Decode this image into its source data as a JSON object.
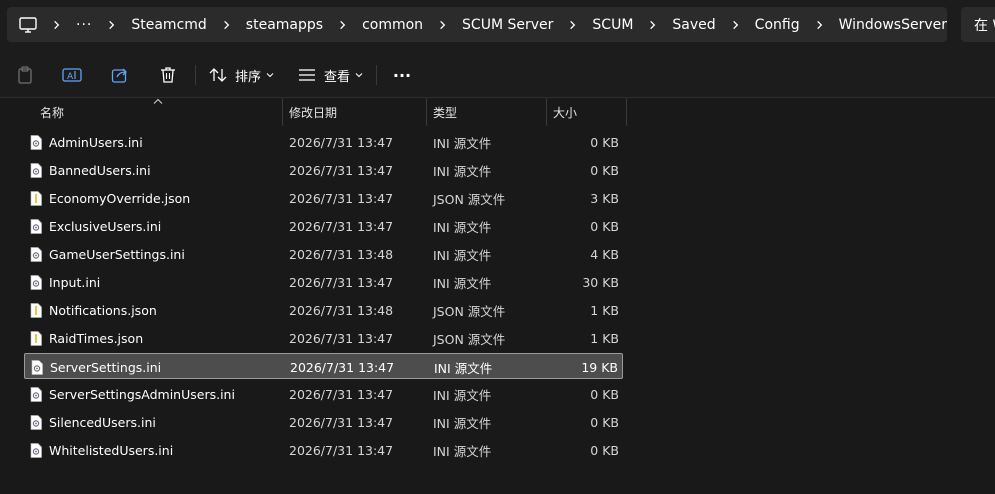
{
  "address_bar": {
    "more_label": "···",
    "crumbs": [
      "Steamcmd",
      "steamapps",
      "common",
      "SCUM Server",
      "SCUM",
      "Saved",
      "Config",
      "WindowsServer"
    ]
  },
  "search": {
    "placeholder": "在 W"
  },
  "toolbar": {
    "sort_label": "排序",
    "view_label": "查看",
    "more_label": "···"
  },
  "columns": {
    "name": "名称",
    "date": "修改日期",
    "type": "类型",
    "size": "大小"
  },
  "files": [
    {
      "name": "AdminUsers.ini",
      "date": "2026/7/31 13:47",
      "type": "INI 源文件",
      "size": "0 KB",
      "kind": "ini"
    },
    {
      "name": "BannedUsers.ini",
      "date": "2026/7/31 13:47",
      "type": "INI 源文件",
      "size": "0 KB",
      "kind": "ini"
    },
    {
      "name": "EconomyOverride.json",
      "date": "2026/7/31 13:47",
      "type": "JSON 源文件",
      "size": "3 KB",
      "kind": "json"
    },
    {
      "name": "ExclusiveUsers.ini",
      "date": "2026/7/31 13:47",
      "type": "INI 源文件",
      "size": "0 KB",
      "kind": "ini"
    },
    {
      "name": "GameUserSettings.ini",
      "date": "2026/7/31 13:48",
      "type": "INI 源文件",
      "size": "4 KB",
      "kind": "ini"
    },
    {
      "name": "Input.ini",
      "date": "2026/7/31 13:47",
      "type": "INI 源文件",
      "size": "30 KB",
      "kind": "ini"
    },
    {
      "name": "Notifications.json",
      "date": "2026/7/31 13:48",
      "type": "JSON 源文件",
      "size": "1 KB",
      "kind": "json"
    },
    {
      "name": "RaidTimes.json",
      "date": "2026/7/31 13:47",
      "type": "JSON 源文件",
      "size": "1 KB",
      "kind": "json"
    },
    {
      "name": "ServerSettings.ini",
      "date": "2026/7/31 13:47",
      "type": "INI 源文件",
      "size": "19 KB",
      "kind": "ini",
      "selected": true
    },
    {
      "name": "ServerSettingsAdminUsers.ini",
      "date": "2026/7/31 13:47",
      "type": "INI 源文件",
      "size": "0 KB",
      "kind": "ini"
    },
    {
      "name": "SilencedUsers.ini",
      "date": "2026/7/31 13:47",
      "type": "INI 源文件",
      "size": "0 KB",
      "kind": "ini"
    },
    {
      "name": "WhitelistedUsers.ini",
      "date": "2026/7/31 13:47",
      "type": "INI 源文件",
      "size": "0 KB",
      "kind": "ini"
    }
  ],
  "icons": {
    "computer": "computer-icon",
    "chevron": "chevron-right-icon",
    "paste": "paste-icon",
    "rename": "rename-icon",
    "share": "share-icon",
    "delete": "trash-icon",
    "sort": "sort-icon",
    "view": "view-icon",
    "ini_file": "ini-file-icon",
    "json_file": "json-file-icon"
  },
  "colors": {
    "background": "#191919",
    "bar": "#2b2b2b",
    "selected_row": "#4d4d4d",
    "accent_blue": "#60a5fa"
  }
}
